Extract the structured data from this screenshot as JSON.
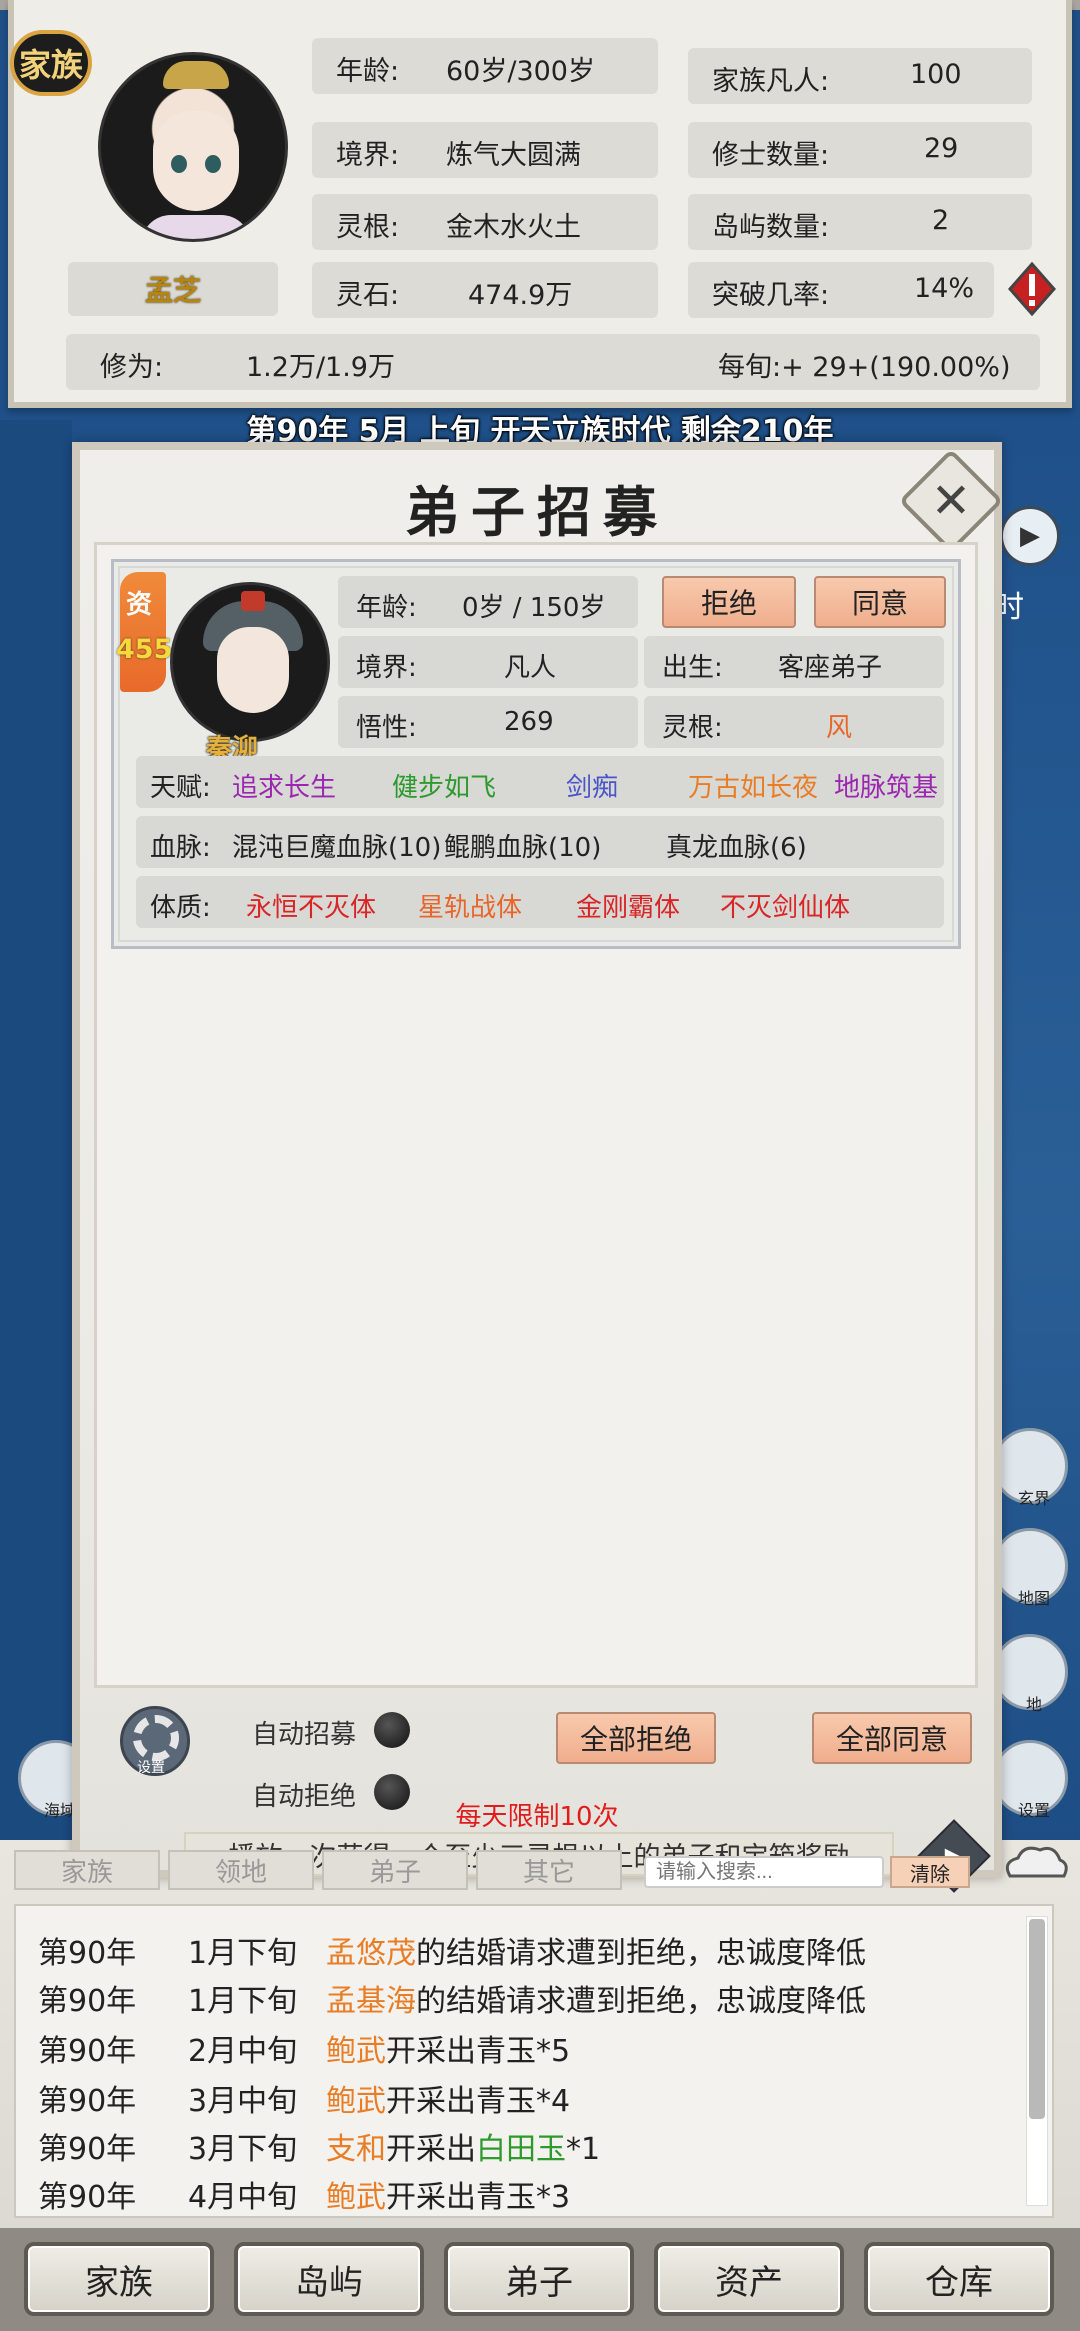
{
  "header": {
    "clan_badge": "家族",
    "leader_name": "孟芝",
    "stats_left": [
      {
        "label": "年龄:",
        "value": "60岁/300岁"
      },
      {
        "label": "境界:",
        "value": "炼气大圆满"
      },
      {
        "label": "灵根:",
        "value": "金木水火土"
      },
      {
        "label": "灵石:",
        "value": "474.9万"
      }
    ],
    "stats_right": [
      {
        "label": "家族凡人:",
        "value": "100"
      },
      {
        "label": "修士数量:",
        "value": "29"
      },
      {
        "label": "岛屿数量:",
        "value": "2"
      },
      {
        "label": "突破几率:",
        "value": "14%"
      }
    ],
    "cultivation_label": "修为:",
    "cultivation_value": "1.2万/1.9万",
    "per_period": "每旬:+ 29+(190.00%)"
  },
  "date_line": "第90年 5月 上旬  开天立族时代 剩余210年",
  "dialog": {
    "title": "弟子招募",
    "close_icon": "close-icon",
    "candidate": {
      "aptitude_label": "资",
      "aptitude_value": "455",
      "name": "秦泖",
      "age_label": "年龄:",
      "age_value": "0岁 / 150岁",
      "realm_label": "境界:",
      "realm_value": "凡人",
      "comprehension_label": "悟性:",
      "comprehension_value": "269",
      "origin_label": "出生:",
      "origin_value": "客座弟子",
      "root_label": "灵根:",
      "root_value": "风",
      "reject_label": "拒绝",
      "accept_label": "同意",
      "talents_label": "天赋:",
      "talents": [
        {
          "text": "追求长生",
          "color": "#9b27b0"
        },
        {
          "text": "健步如飞",
          "color": "#2e9a2e"
        },
        {
          "text": "剑痴",
          "color": "#4a55c8"
        },
        {
          "text": "万古如长夜",
          "color": "#e87d25"
        },
        {
          "text": "地脉筑基",
          "color": "#9b27b0"
        }
      ],
      "bloodline_label": "血脉:",
      "bloodlines": [
        "混沌巨魔血脉(10)",
        "鲲鹏血脉(10)",
        "真龙血脉(6)"
      ],
      "physique_label": "体质:",
      "physiques": [
        {
          "text": "永恒不灭体",
          "color": "#d92525"
        },
        {
          "text": "星轨战体",
          "color": "#e8662a"
        },
        {
          "text": "金刚霸体",
          "color": "#d92525"
        },
        {
          "text": "不灭剑仙体",
          "color": "#d92525"
        }
      ]
    },
    "settings_caption": "设置",
    "auto_recruit_label": "自动招募",
    "auto_reject_label": "自动拒绝",
    "reject_all_label": "全部拒绝",
    "accept_all_label": "全部同意",
    "limit_text": "每天限制10次",
    "video_text": "播放一次获得一个至少三灵根以上的弟子和宝箱奖励"
  },
  "side": {
    "play_icon": "play-icon",
    "time_char": "时",
    "icons": [
      {
        "name": "realm-icon",
        "caption": "玄界"
      },
      {
        "name": "map-pin-icon",
        "caption": "地图"
      },
      {
        "name": "land-icon",
        "caption": "地"
      },
      {
        "name": "gear-icon",
        "caption": "设置"
      }
    ],
    "left_icon_caption": "海域"
  },
  "log": {
    "tabs": [
      "家族",
      "领地",
      "弟子",
      "其它"
    ],
    "search_placeholder": "请输入搜索...",
    "clear_label": "清除",
    "rows": [
      {
        "year": "第90年",
        "time": "1月下旬",
        "name": "孟悠茂",
        "name_color": "orange",
        "rest": "的结婚请求遭到拒绝，忠诚度降低"
      },
      {
        "year": "第90年",
        "time": "1月下旬",
        "name": "孟基海",
        "name_color": "orange",
        "rest": "的结婚请求遭到拒绝，忠诚度降低"
      },
      {
        "year": "第90年",
        "time": "2月中旬",
        "name": "鲍武",
        "name_color": "orange",
        "rest": "开采出青玉*5"
      },
      {
        "year": "第90年",
        "time": "3月中旬",
        "name": "鲍武",
        "name_color": "orange",
        "rest": "开采出青玉*4"
      },
      {
        "year": "第90年",
        "time": "3月下旬",
        "name": "支和",
        "name_color": "orange",
        "rest_pre": "开采出",
        "item": "白田玉",
        "rest": "*1"
      },
      {
        "year": "第90年",
        "time": "4月中旬",
        "name": "鲍武",
        "name_color": "orange",
        "rest": "开采出青玉*3"
      }
    ]
  },
  "nav": [
    "家族",
    "岛屿",
    "弟子",
    "资产",
    "仓库"
  ]
}
